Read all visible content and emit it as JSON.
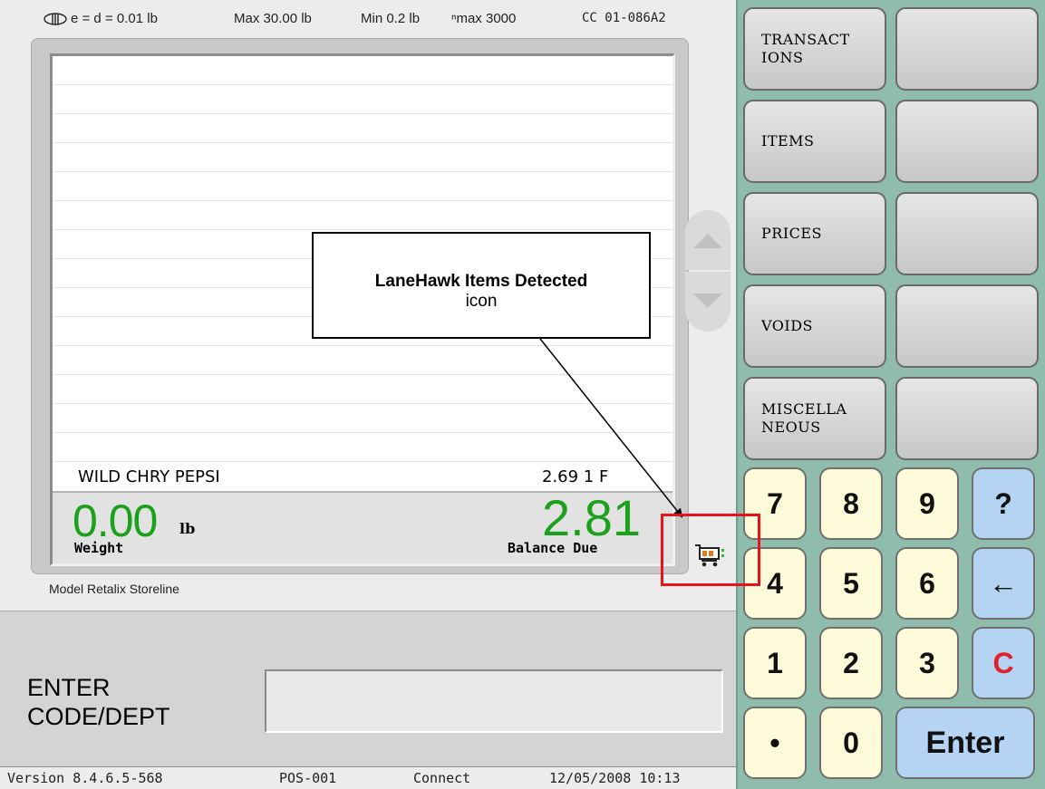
{
  "scale_specs": {
    "ci_text": "e = d = 0.01 lb",
    "max": "Max 30.00 lb",
    "min": "Min 0.2 lb",
    "nmax": "ⁿmax 3000",
    "cc": "CC 01-086A2"
  },
  "receipt": {
    "item_name": "WILD CHRY PEPSI",
    "item_price": "2.69 1  F"
  },
  "totals": {
    "weight_value": "0.00",
    "weight_unit": "lb",
    "weight_label": "Weight",
    "balance_value": "2.81",
    "balance_label": "Balance Due"
  },
  "model_label": "Model Retalix Storeline",
  "prompt": {
    "line1": "ENTER",
    "line2": "CODE/DEPT",
    "input_value": ""
  },
  "status": {
    "version": "Version 8.4.6.5-568",
    "pos": "POS-001",
    "connection": "Connect",
    "datetime": "12/05/2008 10:13"
  },
  "function_buttons": [
    {
      "line1": "TRANSACT",
      "line2": "IONS"
    },
    {
      "line1": "ITEMS",
      "line2": ""
    },
    {
      "line1": "PRICES",
      "line2": ""
    },
    {
      "line1": "VOIDS",
      "line2": ""
    },
    {
      "line1": "MISCELLA",
      "line2": "NEOUS"
    }
  ],
  "numpad": {
    "k7": "7",
    "k8": "8",
    "k9": "9",
    "help": "?",
    "k4": "4",
    "k5": "5",
    "k6": "6",
    "back": "←",
    "k1": "1",
    "k2": "2",
    "k3": "3",
    "clear": "C",
    "dot": "•",
    "k0": "0",
    "enter": "Enter"
  },
  "callout": {
    "title": "LaneHawk Items Detected",
    "subtitle": "icon"
  },
  "icons": {
    "scale_class": "scale-class-icon",
    "cart": "shopping-cart-icon",
    "scroll_up": "scroll-up-icon",
    "scroll_down": "scroll-down-icon"
  },
  "colors": {
    "green_amount": "#1ca11c",
    "panel_teal": "#8fbcad",
    "numkey_cream": "#fcfad8",
    "numkey_blue": "#b5d3f2",
    "clear_red": "#e0202a",
    "highlight_red": "#e8121a"
  }
}
